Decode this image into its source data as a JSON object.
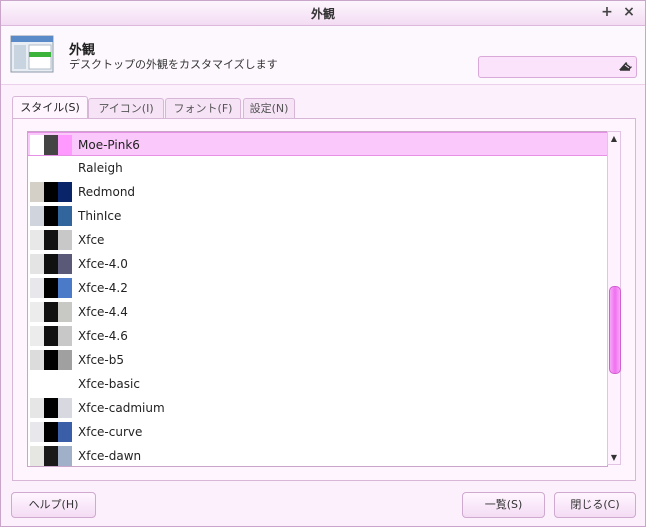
{
  "window": {
    "title": "外観"
  },
  "titlebar": {
    "maximize_symbol": "+",
    "close_symbol": "×"
  },
  "header": {
    "title": "外観",
    "subtitle": "デスクトップの外観をカスタマイズします",
    "search_placeholder": ""
  },
  "tabs": [
    {
      "label": "スタイル(S)",
      "active": true
    },
    {
      "label": "アイコン(I)",
      "active": false
    },
    {
      "label": "フォント(F)",
      "active": false
    },
    {
      "label": "設定(N)",
      "active": false
    }
  ],
  "styles": [
    {
      "name": "Moe-Pink6",
      "selected": true,
      "swatches": [
        "#ffffff",
        "#444444",
        "#ff99ff"
      ]
    },
    {
      "name": "Raleigh",
      "selected": false,
      "swatches": []
    },
    {
      "name": "Redmond",
      "selected": false,
      "swatches": [
        "#d4d0c8",
        "#000000",
        "#0a246a"
      ]
    },
    {
      "name": "ThinIce",
      "selected": false,
      "swatches": [
        "#d0d4dc",
        "#000000",
        "#31659c"
      ]
    },
    {
      "name": "Xfce",
      "selected": false,
      "swatches": [
        "#e8e8e8",
        "#111111",
        "#c8c8c8"
      ]
    },
    {
      "name": "Xfce-4.0",
      "selected": false,
      "swatches": [
        "#e4e4e4",
        "#111111",
        "#5a5a78"
      ]
    },
    {
      "name": "Xfce-4.2",
      "selected": false,
      "swatches": [
        "#e8e8ec",
        "#000000",
        "#4a7ac8"
      ]
    },
    {
      "name": "Xfce-4.4",
      "selected": false,
      "swatches": [
        "#ececec",
        "#111111",
        "#c8c8c4"
      ]
    },
    {
      "name": "Xfce-4.6",
      "selected": false,
      "swatches": [
        "#ececec",
        "#111111",
        "#c8c8c8"
      ]
    },
    {
      "name": "Xfce-b5",
      "selected": false,
      "swatches": [
        "#dcdcdc",
        "#000000",
        "#a0a0a0"
      ]
    },
    {
      "name": "Xfce-basic",
      "selected": false,
      "swatches": []
    },
    {
      "name": "Xfce-cadmium",
      "selected": false,
      "swatches": [
        "#e6e6e6",
        "#000000",
        "#d8d8e0"
      ]
    },
    {
      "name": "Xfce-curve",
      "selected": false,
      "swatches": [
        "#e8e8ec",
        "#000000",
        "#3a5fa8"
      ]
    },
    {
      "name": "Xfce-dawn",
      "selected": false,
      "swatches": [
        "#e6e6e2",
        "#1a1a1a",
        "#a0b0c8"
      ]
    }
  ],
  "buttons": {
    "help": "ヘルプ(H)",
    "all": "一覧(S)",
    "close": "閉じる(C)"
  },
  "colors": {
    "accent": "#f070f0",
    "selection": "#fac8fa",
    "border": "#d7b6d7"
  }
}
